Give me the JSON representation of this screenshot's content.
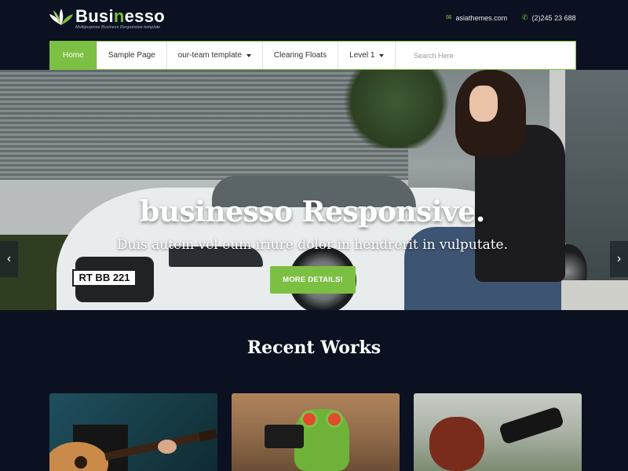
{
  "brand": {
    "name_part1": "Busi",
    "name_accent": "n",
    "name_part2": "esso",
    "tagline": "Multipurpose Business Responsive template",
    "accent_color": "#7cc043"
  },
  "contact": {
    "email_icon": "envelope-icon",
    "email": "asiathemes.com",
    "phone_icon": "phone-icon",
    "phone": "(2)245 23 688"
  },
  "nav": {
    "items": [
      {
        "label": "Home",
        "active": true
      },
      {
        "label": "Sample Page"
      },
      {
        "label": "our-team template",
        "dropdown": true
      },
      {
        "label": "Clearing Floats"
      },
      {
        "label": "Level 1",
        "dropdown": true
      }
    ],
    "search_placeholder": "Search Here"
  },
  "hero": {
    "title": "businesso Responsive.",
    "subtitle": "Duis autem vel eum iriure dolor in hendrerit in vulputate.",
    "button_label": "MORE DETAILS!",
    "plate_text": "RT BB 221",
    "prev_arrow": "‹",
    "next_arrow": "›"
  },
  "recent_works": {
    "title": "Recent Works"
  }
}
